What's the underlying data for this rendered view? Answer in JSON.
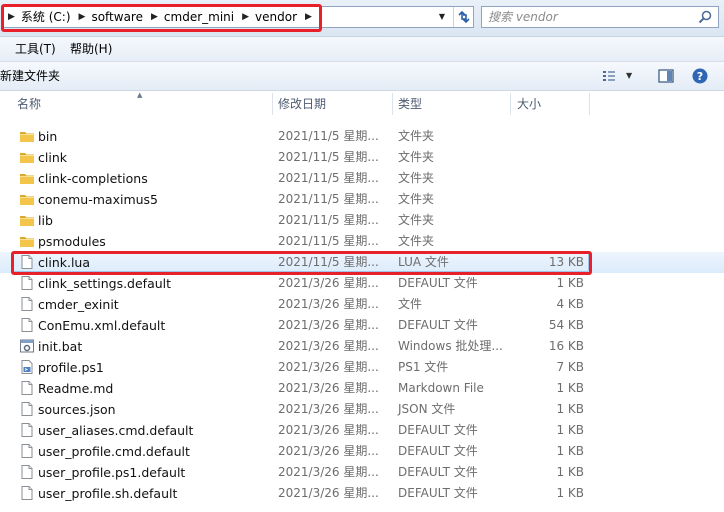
{
  "address": {
    "crumbs": [
      "系统 (C:)",
      "software",
      "cmder_mini",
      "vendor"
    ],
    "search_placeholder": "搜索 vendor"
  },
  "menu": {
    "tools": "工具(T)",
    "help": "帮助(H)"
  },
  "toolbar": {
    "new_folder": "新建文件夹"
  },
  "columns": {
    "name": "名称",
    "date": "修改日期",
    "type": "类型",
    "size": "大小"
  },
  "files": [
    {
      "name": "bin",
      "date": "2021/11/5 星期...",
      "type": "文件夹",
      "size": "",
      "icon": "folder-icon"
    },
    {
      "name": "clink",
      "date": "2021/11/5 星期...",
      "type": "文件夹",
      "size": "",
      "icon": "folder-icon"
    },
    {
      "name": "clink-completions",
      "date": "2021/11/5 星期...",
      "type": "文件夹",
      "size": "",
      "icon": "folder-icon"
    },
    {
      "name": "conemu-maximus5",
      "date": "2021/11/5 星期...",
      "type": "文件夹",
      "size": "",
      "icon": "folder-icon"
    },
    {
      "name": "lib",
      "date": "2021/11/5 星期...",
      "type": "文件夹",
      "size": "",
      "icon": "folder-icon"
    },
    {
      "name": "psmodules",
      "date": "2021/11/5 星期...",
      "type": "文件夹",
      "size": "",
      "icon": "folder-icon"
    },
    {
      "name": "clink.lua",
      "date": "2021/11/5 星期...",
      "type": "LUA 文件",
      "size": "13 KB",
      "icon": "file-icon",
      "selected": true
    },
    {
      "name": "clink_settings.default",
      "date": "2021/3/26 星期...",
      "type": "DEFAULT 文件",
      "size": "1 KB",
      "icon": "file-icon"
    },
    {
      "name": "cmder_exinit",
      "date": "2021/3/26 星期...",
      "type": "文件",
      "size": "4 KB",
      "icon": "file-icon"
    },
    {
      "name": "ConEmu.xml.default",
      "date": "2021/3/26 星期...",
      "type": "DEFAULT 文件",
      "size": "54 KB",
      "icon": "file-icon"
    },
    {
      "name": "init.bat",
      "date": "2021/3/26 星期...",
      "type": "Windows 批处理...",
      "size": "16 KB",
      "icon": "batch-file-icon"
    },
    {
      "name": "profile.ps1",
      "date": "2021/3/26 星期...",
      "type": "PS1 文件",
      "size": "7 KB",
      "icon": "script-file-icon"
    },
    {
      "name": "Readme.md",
      "date": "2021/3/26 星期...",
      "type": "Markdown File",
      "size": "1 KB",
      "icon": "file-icon"
    },
    {
      "name": "sources.json",
      "date": "2021/3/26 星期...",
      "type": "JSON 文件",
      "size": "1 KB",
      "icon": "file-icon"
    },
    {
      "name": "user_aliases.cmd.default",
      "date": "2021/3/26 星期...",
      "type": "DEFAULT 文件",
      "size": "1 KB",
      "icon": "file-icon"
    },
    {
      "name": "user_profile.cmd.default",
      "date": "2021/3/26 星期...",
      "type": "DEFAULT 文件",
      "size": "1 KB",
      "icon": "file-icon"
    },
    {
      "name": "user_profile.ps1.default",
      "date": "2021/3/26 星期...",
      "type": "DEFAULT 文件",
      "size": "1 KB",
      "icon": "file-icon"
    },
    {
      "name": "user_profile.sh.default",
      "date": "2021/3/26 星期...",
      "type": "DEFAULT 文件",
      "size": "1 KB",
      "icon": "file-icon"
    }
  ],
  "colors": {
    "highlight": "#e8202a",
    "selection": "#dcebfc",
    "folder": "#f3c54b"
  }
}
